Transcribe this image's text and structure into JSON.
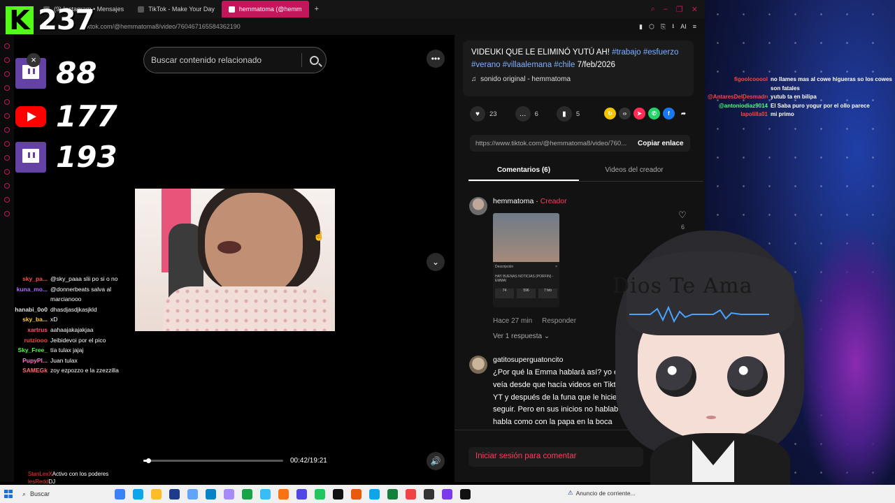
{
  "browser": {
    "tabs": [
      {
        "label": "(9) Instagram • Mensajes",
        "active": false
      },
      {
        "label": "TikTok - Make Your Day",
        "active": false
      },
      {
        "label": "hemmatoma (@hemm",
        "active": true
      }
    ],
    "new_tab": "+",
    "url": "tiktok.com/@hemmatoma8/video/760467165584362190"
  },
  "overlay": {
    "kick_count": "237",
    "twitch_count_1": "88",
    "youtube_count": "177",
    "twitch_count_2": "193",
    "close": "×"
  },
  "left_chat": [
    {
      "user": "sky_pa...",
      "color": "#ff4d4d",
      "msg": "@sky_paaa slii po si o no"
    },
    {
      "user": "kuna_mo...",
      "color": "#b06bff",
      "msg": "@donnerbeats salva al marcianooo"
    },
    {
      "user": "hanabi_0o0",
      "color": "#e0e0e0",
      "msg": "dhasdjasdjkasjkld"
    },
    {
      "user": "sky_ba...",
      "color": "#ffcc33",
      "msg": "xD"
    },
    {
      "user": "xartrus",
      "color": "#ff5577",
      "msg": "aahaajakajakjaa"
    },
    {
      "user": "rutziooo",
      "color": "#ff4444",
      "msg": "Jeibidevoi por el pico"
    },
    {
      "user": "Sky_Free_",
      "color": "#45ff45",
      "msg": "tía tulax jajaj"
    },
    {
      "user": "PupyPl...",
      "color": "#ff77cc",
      "msg": "Juan tulax"
    },
    {
      "user": "SAMEGk",
      "color": "#ff6e6e",
      "msg": "zoy ezpozzo e la zzezzilla"
    }
  ],
  "left_chat_bottom": [
    {
      "user": "StanLexX",
      "color": "#ff3333",
      "msg": "Activo con los poderes"
    },
    {
      "user": "lesRedd",
      "color": "#ff3333",
      "msg": "DJ"
    }
  ],
  "tiktok": {
    "search_placeholder": "Buscar contenido relacionado",
    "current_time": "00:42/19:21",
    "progress": 0.036,
    "description_prefix": "VIDEUKI QUE LE ELIMINÓ YUTÚ AH! ",
    "hashtags": [
      "#trabajo",
      "#esfuerzo",
      "#verano",
      "#villaalemana",
      "#chile"
    ],
    "date": "7/feb/2026",
    "sound": "sonido original - hemmatoma",
    "likes": "23",
    "comments": "6",
    "saves": "5",
    "link": "https://www.tiktok.com/@hemmatoma8/video/760...",
    "copy_label": "Copiar enlace",
    "tab_comments": "Comentarios (6)",
    "tab_creator": "Videos del creador",
    "comment1": {
      "user": "hemmatoma",
      "separator": " · ",
      "badge": "Creador",
      "time": "Hace 27 min",
      "reply": "Responder",
      "replies": "Ver 1 respuesta ⌄",
      "like_count": "6"
    },
    "thumb": {
      "label": "Descripción",
      "close": "×",
      "headline": "HAY BUENAS NOTICIAS (PORFIN) - EMMA!",
      "stats": [
        "74",
        "596",
        "7 feb"
      ]
    },
    "comment2": {
      "user": "gatitosuperguatoncito",
      "text": "¿Por qué la Emma hablará así? yo e veía desde que hacía videos en Tikt YT y después de la funa que le hicie seguir. Pero en sus inicios no hablab habla como con la papa en la boca"
    },
    "login_prompt": "Iniciar sesión para comentar"
  },
  "right_chat": [
    {
      "user": "figoolcooool",
      "color": "#ff4444",
      "msg": "no llames mas al cowe higueras so los cowes son fatales"
    },
    {
      "user": "@AntaresDelDesmadre",
      "color": "#ff4444",
      "msg": "yutub ta en bilipa"
    },
    {
      "user": "@antoniodiaz9014",
      "color": "#45ff7a",
      "msg": "El Saba puro yogur por el ollo parece"
    },
    {
      "user": "lapolilla01",
      "color": "#ff4444",
      "msg": "mi primo"
    }
  ],
  "vtuber_sign": "Dios Te Ama",
  "taskbar": {
    "search": "Buscar",
    "notice": "Anuncio de corriente..."
  },
  "colors": {
    "tiktok_red": "#ff3b5c",
    "kick_green": "#53fc18",
    "twitch_purple": "#6441a5",
    "youtube_red": "#ff0000",
    "hashtag_blue": "#7fb0ff"
  }
}
